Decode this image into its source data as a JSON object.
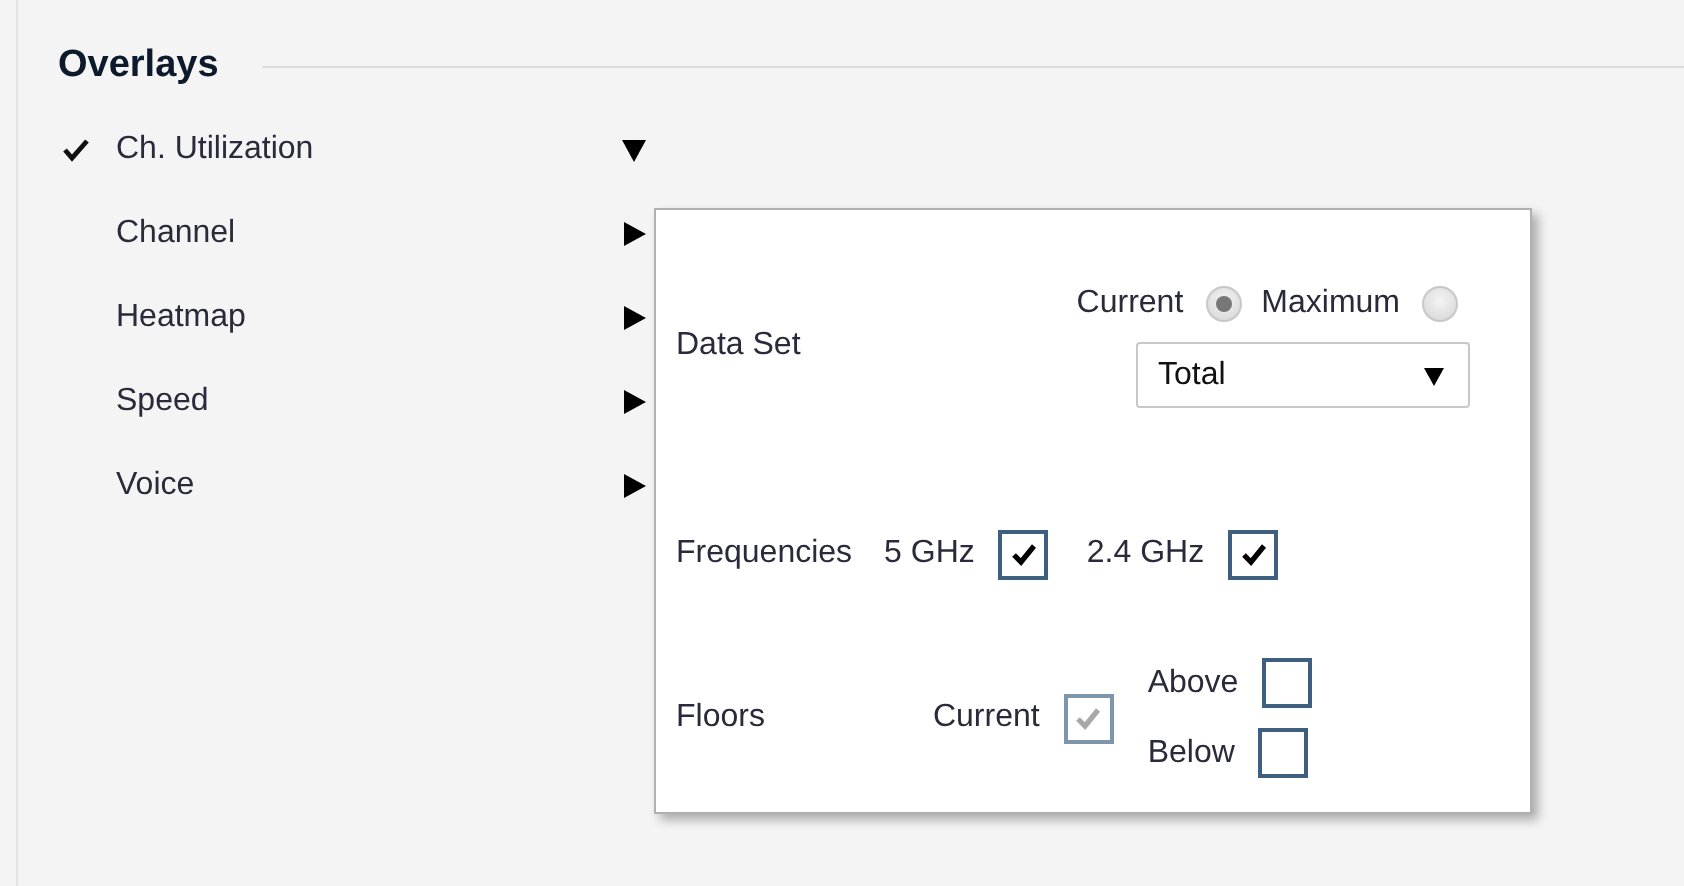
{
  "section": {
    "title": "Overlays"
  },
  "items": [
    {
      "label": "Ch. Utilization",
      "checked": true,
      "expanded": true
    },
    {
      "label": "Channel",
      "checked": false,
      "expanded": false
    },
    {
      "label": "Heatmap",
      "checked": false,
      "expanded": false
    },
    {
      "label": "Speed",
      "checked": false,
      "expanded": false
    },
    {
      "label": "Voice",
      "checked": false,
      "expanded": false
    }
  ],
  "panel": {
    "data_set": {
      "label": "Data Set",
      "options": [
        {
          "label": "Current",
          "selected": true
        },
        {
          "label": "Maximum",
          "selected": false
        }
      ],
      "dropdown": {
        "value": "Total"
      }
    },
    "frequencies": {
      "label": "Frequencies",
      "options": [
        {
          "label": "5 GHz",
          "checked": true,
          "disabled": false
        },
        {
          "label": "2.4 GHz",
          "checked": true,
          "disabled": false
        }
      ]
    },
    "floors": {
      "label": "Floors",
      "options": [
        {
          "label": "Current",
          "checked": true,
          "disabled": true
        },
        {
          "label": "Above",
          "checked": false,
          "disabled": false
        },
        {
          "label": "Below",
          "checked": false,
          "disabled": false
        }
      ]
    }
  }
}
